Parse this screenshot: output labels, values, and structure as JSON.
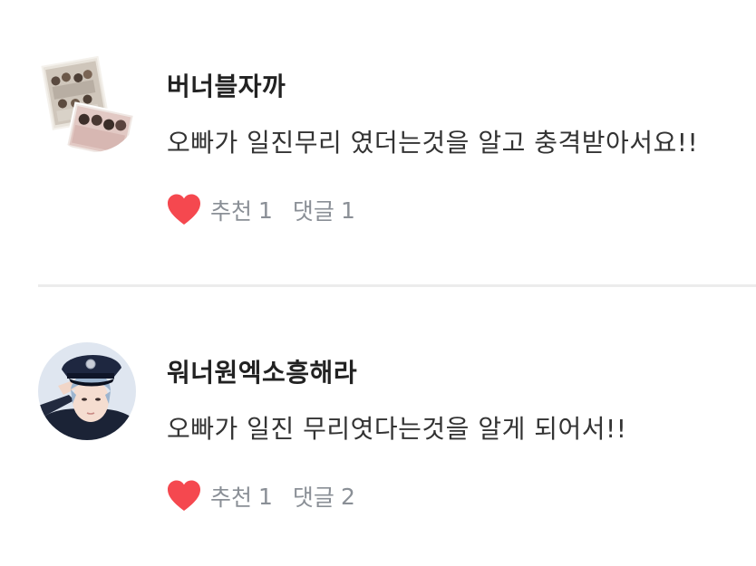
{
  "comments": [
    {
      "nickname": "버너블자까",
      "text": "오빠가 일진무리 였더는것을 알고 충격받아서요!!",
      "like_label": "추천",
      "like_count": "1",
      "reply_label": "댓글",
      "reply_count": "1",
      "heart_color": "#f5484f"
    },
    {
      "nickname": "워너원엑소흥해라",
      "text": "오빠가 일진 무리엿다는것을 알게 되어서!!",
      "like_label": "추천",
      "like_count": "1",
      "reply_label": "댓글",
      "reply_count": "2",
      "heart_color": "#f5484f"
    }
  ],
  "icons": {
    "like": "heart-icon",
    "avatar_1": "avatar-photo-collage",
    "avatar_2": "avatar-police-cap-salute"
  },
  "colors": {
    "background": "#ffffff",
    "text_primary": "#222222",
    "text_meta": "#8a8f96",
    "divider": "#ececec",
    "heart": "#f5484f"
  }
}
